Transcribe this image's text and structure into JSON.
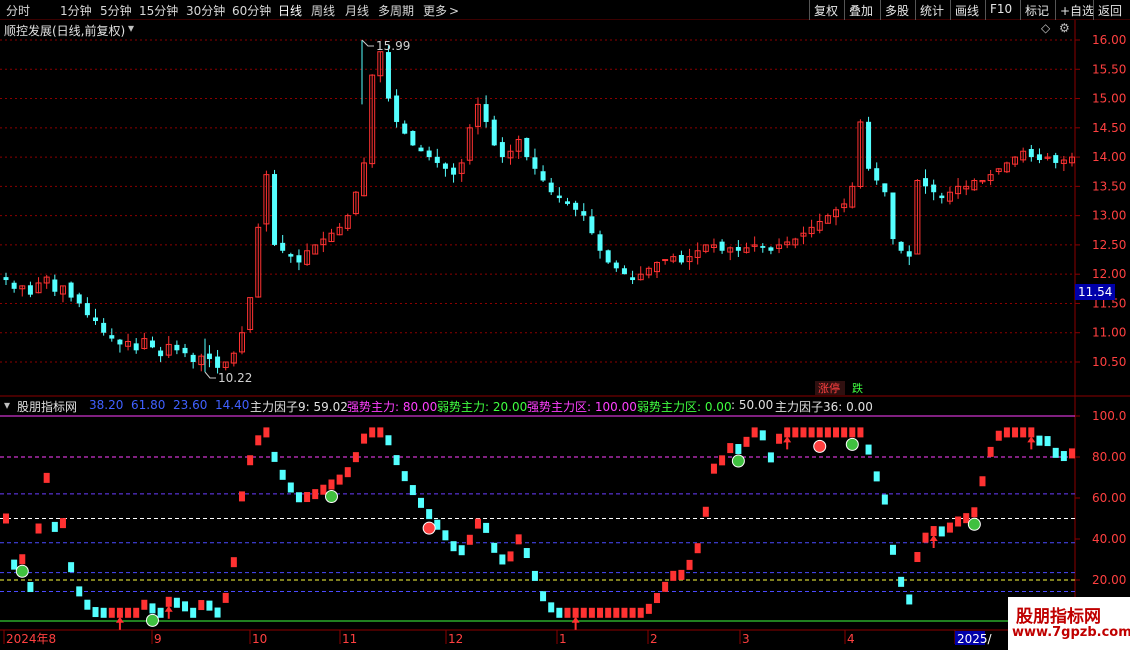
{
  "toolbar": {
    "periods": [
      {
        "label": "分时",
        "active": false
      },
      {
        "label": "1分钟",
        "active": false
      },
      {
        "label": "5分钟",
        "active": false
      },
      {
        "label": "15分钟",
        "active": false
      },
      {
        "label": "30分钟",
        "active": false
      },
      {
        "label": "60分钟",
        "active": false
      },
      {
        "label": "日线",
        "active": true
      },
      {
        "label": "周线",
        "active": false
      },
      {
        "label": "月线",
        "active": false
      },
      {
        "label": "多周期",
        "active": false
      },
      {
        "label": "更多",
        "active": false
      }
    ],
    "more_chevron": ">",
    "right_buttons": [
      "复权",
      "叠加",
      "多股",
      "统计",
      "画线",
      "F10",
      "标记",
      "+自选",
      "返回"
    ]
  },
  "main_panel": {
    "title": "顺控发展(日线,前复权)",
    "price_axis": [
      "16.00",
      "15.50",
      "15.00",
      "14.50",
      "14.00",
      "13.50",
      "13.00",
      "12.50",
      "12.00",
      "11.50",
      "11.00",
      "10.50"
    ],
    "current_price": "11.54",
    "high_label": "15.99",
    "low_label": "10.22",
    "limit_up_badge": "涨停",
    "limit_down_badge": "跌"
  },
  "indicator_panel": {
    "title": "股朋指标网",
    "params": [
      "38.20",
      "61.80",
      "23.60",
      "14.40"
    ],
    "items": [
      {
        "label": "主力因子9: 59.02",
        "color": "#e0e0e0"
      },
      {
        "label": "强势主力: 80.00",
        "color": "#ff40ff"
      },
      {
        "label": "弱势主力: 20.00",
        "color": "#40ff40"
      },
      {
        "label": "强势主力区: 100.00",
        "color": "#ff40ff"
      },
      {
        "label": "弱势主力区: 0.00",
        "color": "#40ff40"
      },
      {
        "label": ": 50.00",
        "color": "#e0e0e0"
      },
      {
        "label": "主力因子36: 0.00",
        "color": "#e0e0e0"
      }
    ],
    "axis": [
      "100.0",
      "80.00",
      "60.00",
      "40.00",
      "20.00"
    ]
  },
  "date_axis": [
    {
      "label": "2024年8"
    },
    {
      "label": "9"
    },
    {
      "label": "10"
    },
    {
      "label": "11"
    },
    {
      "label": "12"
    },
    {
      "label": "1"
    },
    {
      "label": "2"
    },
    {
      "label": "3"
    },
    {
      "label": "4"
    },
    {
      "label": "2025/"
    }
  ],
  "watermark": {
    "line1": "股朋指标网",
    "line2": "www.7gpzb.com"
  },
  "colors": {
    "up": "#ff3232",
    "down": "#54ffff",
    "grid": "#8b0000",
    "magenta": "#ff40ff",
    "green": "#40ff40"
  },
  "chart_data": {
    "type": "candlestick",
    "y_range": [
      10.0,
      16.3
    ],
    "high": 15.99,
    "low": 10.22,
    "last": 11.54,
    "close_series": [
      11.9,
      11.75,
      11.8,
      11.65,
      11.85,
      11.95,
      11.7,
      11.8,
      11.6,
      11.5,
      11.3,
      11.2,
      11.0,
      10.9,
      10.8,
      10.85,
      10.7,
      10.9,
      10.75,
      10.6,
      10.8,
      10.7,
      10.65,
      10.5,
      10.6,
      10.55,
      10.4,
      10.5,
      10.65,
      11.0,
      11.6,
      12.8,
      13.7,
      12.5,
      12.4,
      12.3,
      12.2,
      12.4,
      12.5,
      12.6,
      12.7,
      12.8,
      13.0,
      13.4,
      13.9,
      15.4,
      15.8,
      15.0,
      14.6,
      14.4,
      14.2,
      14.1,
      14.0,
      13.9,
      13.8,
      13.7,
      13.9,
      14.5,
      14.9,
      14.6,
      14.2,
      14.0,
      14.1,
      14.3,
      14.0,
      13.8,
      13.6,
      13.4,
      13.3,
      13.2,
      13.1,
      13.0,
      12.7,
      12.4,
      12.2,
      12.1,
      12.0,
      11.9,
      12.0,
      12.1,
      12.2,
      12.25,
      12.3,
      12.2,
      12.3,
      12.4,
      12.5,
      12.5,
      12.4,
      12.45,
      12.4,
      12.45,
      12.5,
      12.45,
      12.4,
      12.5,
      12.55,
      12.6,
      12.7,
      12.8,
      12.9,
      13.0,
      13.1,
      13.2,
      13.5,
      14.6,
      13.8,
      13.6,
      13.4,
      12.6,
      12.4,
      12.3,
      13.6,
      13.5,
      13.4,
      13.3,
      13.4,
      13.5,
      13.5,
      13.6,
      13.6,
      13.7,
      13.8,
      13.9,
      14.0,
      14.1,
      14.0,
      13.95,
      14.0,
      13.9,
      13.95,
      14.0
    ],
    "indicator": {
      "name": "主力因子9",
      "last": 59.02,
      "strong": 80.0,
      "weak": 20.0,
      "strong_zone": 100.0,
      "weak_zone": 0.0,
      "mid": 50.0,
      "factor36": 0.0,
      "y_range": [
        0,
        105
      ]
    }
  }
}
